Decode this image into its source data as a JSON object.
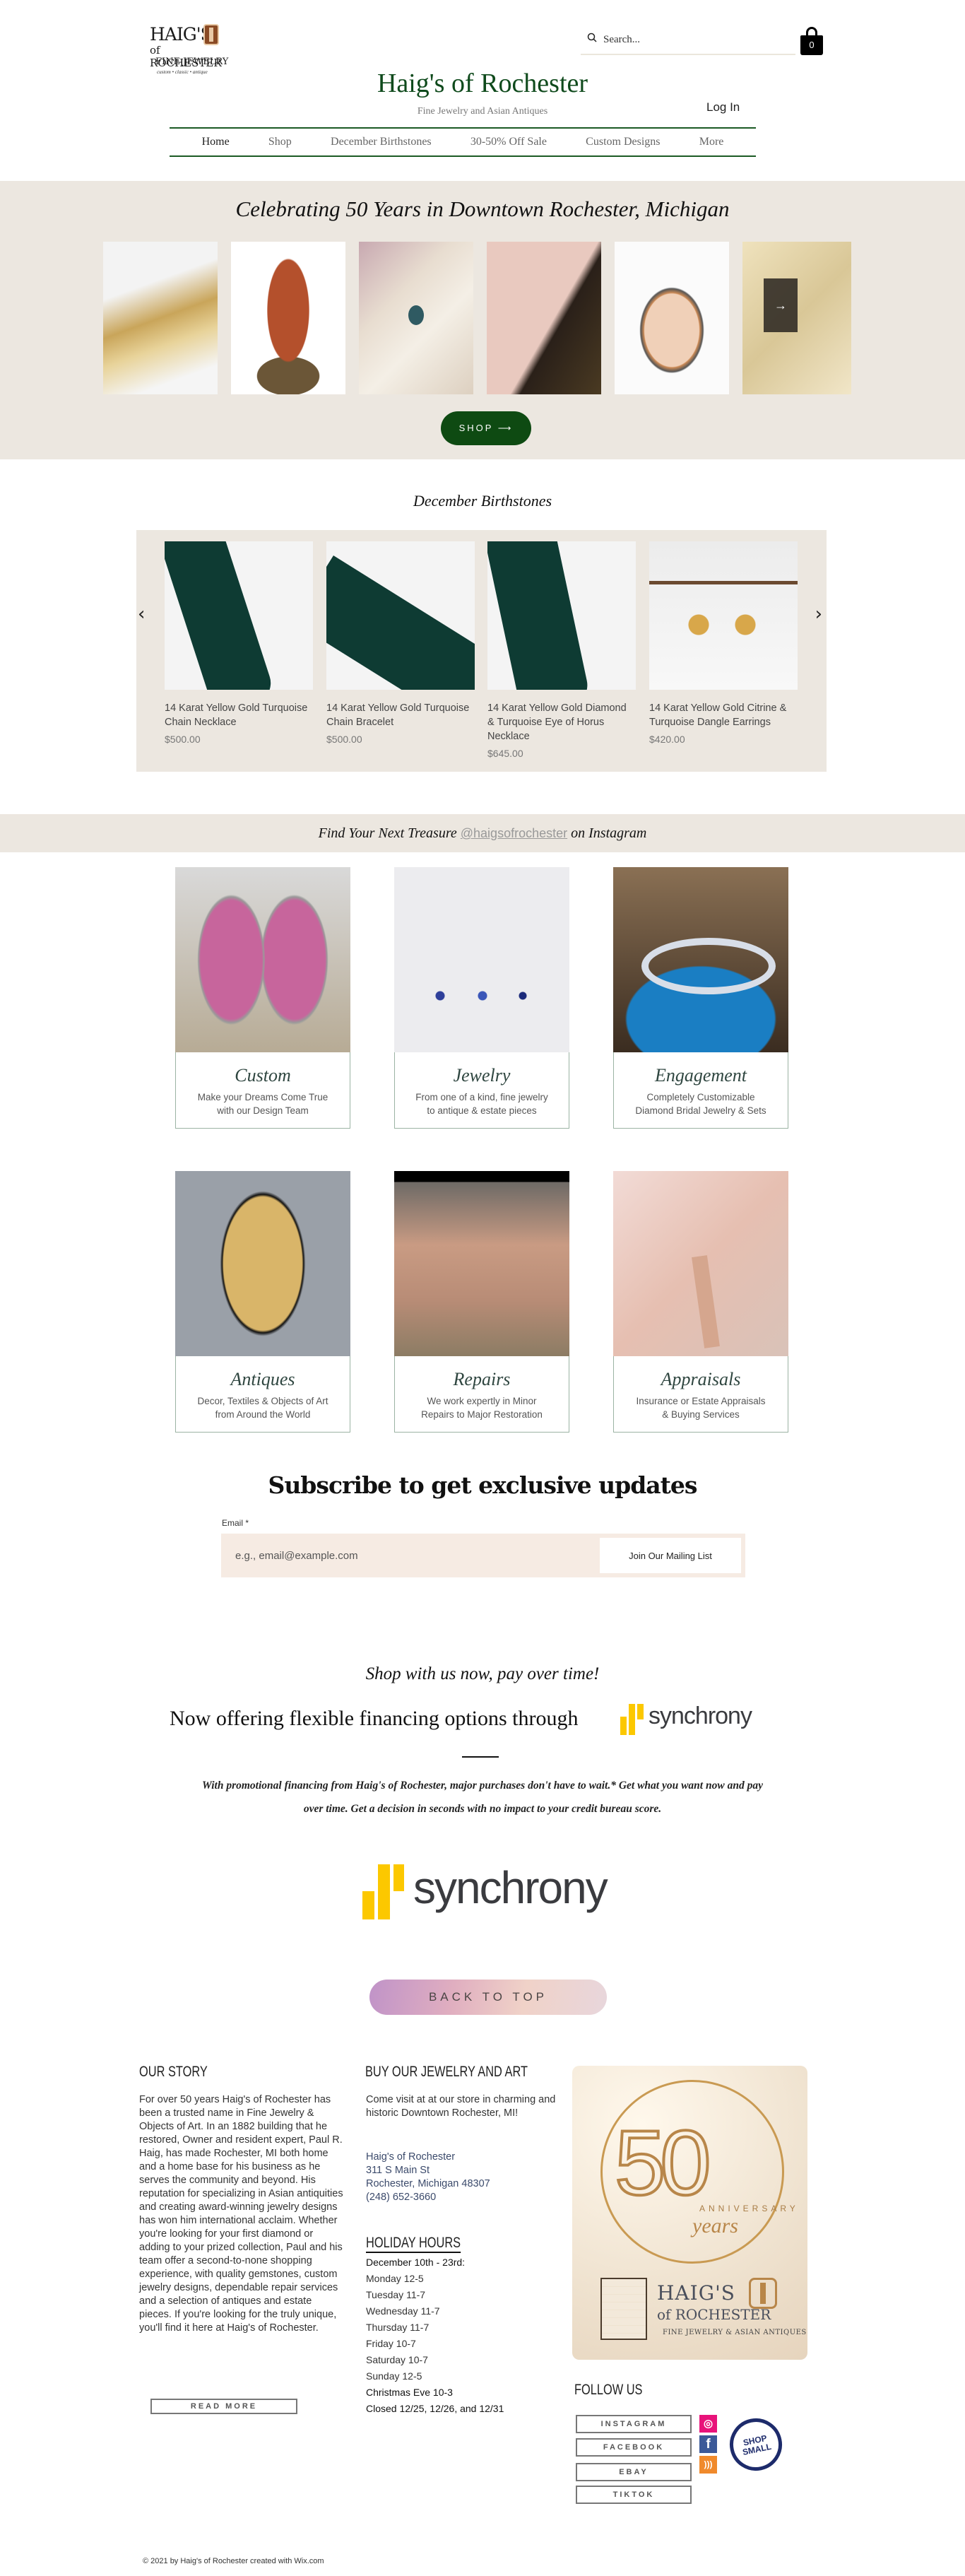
{
  "header": {
    "logo": {
      "line1": "HAIG'S",
      "line2": "of ROCHESTER",
      "line3": "FINE JEWELRY",
      "line4": "custom • classic • antique"
    },
    "search": {
      "placeholder": "Search..."
    },
    "cart": {
      "count": "0"
    },
    "site_title": "Haig's of Rochester",
    "site_subtitle": "Fine Jewelry and Asian Antiques",
    "login_label": "Log In",
    "nav": [
      {
        "label": "Home",
        "active": true
      },
      {
        "label": "Shop"
      },
      {
        "label": "December Birthstones"
      },
      {
        "label": "30-50% Off Sale"
      },
      {
        "label": "Custom Designs"
      },
      {
        "label": "More"
      }
    ]
  },
  "hero": {
    "title": "Celebrating 50 Years in Downtown Rochester, Michigan",
    "gallery_next_icon": "→",
    "shop_label": "SHOP ⟶"
  },
  "birthstones": {
    "title": "December Birthstones",
    "prev_icon": "‹",
    "next_icon": "›",
    "products": [
      {
        "name": "14 Karat Yellow Gold Turquoise Chain Necklace",
        "price": "$500.00"
      },
      {
        "name": "14 Karat Yellow Gold Turquoise Chain Bracelet",
        "price": "$500.00"
      },
      {
        "name": "14 Karat Yellow Gold Diamond & Turquoise Eye of Horus Necklace",
        "price": "$645.00"
      },
      {
        "name": "14 Karat Yellow Gold Citrine & Turquoise Dangle Earrings",
        "price": "$420.00"
      }
    ]
  },
  "instagram": {
    "prefix": "Find Your Next Treasure ",
    "handle": "@haigsofrochester",
    "suffix": " on Instagram"
  },
  "categories": [
    {
      "title": "Custom",
      "line1": "Make your Dreams Come True",
      "line2": "with our Design Team"
    },
    {
      "title": "Jewelry",
      "line1": "From one of a kind, fine jewelry",
      "line2": "to antique & estate pieces"
    },
    {
      "title": "Engagement",
      "line1": "Completely Customizable",
      "line2": "Diamond Bridal Jewelry & Sets"
    },
    {
      "title": "Antiques",
      "line1": "Decor, Textiles & Objects of Art",
      "line2": "from Around the World"
    },
    {
      "title": "Repairs",
      "line1": "We work expertly in Minor",
      "line2": "Repairs to Major Restoration"
    },
    {
      "title": "Appraisals",
      "line1": "Insurance or Estate Appraisals",
      "line2": "& Buying Services"
    }
  ],
  "subscribe": {
    "title": "Subscribe to get exclusive updates",
    "email_label": "Email *",
    "email_placeholder": "e.g., email@example.com",
    "button_label": "Join Our Mailing List"
  },
  "financing": {
    "tagline": "Shop with us now, pay over time!",
    "headline": "Now offering flexible financing options through",
    "brand": "synchrony",
    "body": "With promotional financing from Haig's of Rochester, major purchases don't have to wait.* Get what you want now and pay over time. Get a decision in seconds with no impact to your credit bureau score.",
    "brand_color": "#fcc800"
  },
  "back_to_top_label": "BACK TO TOP",
  "footer": {
    "story": {
      "heading": "OUR STORY",
      "text": "For over 50 years Haig's of Rochester has been a trusted name in Fine Jewelry & Objects of Art. In an 1882 building that he restored, Owner and resident expert, Paul R. Haig, has made Rochester, MI both home and a home base for his business as he serves the community and beyond. His reputation for specializing in Asian antiquities and creating award-winning jewelry designs has won him international acclaim. Whether you're looking for your first diamond or adding to your prized collection, Paul and his team offer a second-to-none shopping experience, with quality gemstones, custom jewelry designs, dependable repair services and a selection of antiques and estate pieces. If you're looking for the truly unique, you'll find it here at Haig's of Rochester.",
      "read_more": "READ MORE"
    },
    "buy": {
      "heading": "BUY OUR JEWELRY AND ART",
      "text": "Come visit at at our store in charming and historic Downtown Rochester, MI!",
      "address_name": "Haig's of Rochester",
      "address_street": "311 S Main St",
      "address_city": "Rochester, Michigan 48307",
      "phone": "(248) 652-3660"
    },
    "hours": {
      "heading": "HOLIDAY HOURS",
      "range": "December 10th - 23rd:",
      "days": [
        "Monday 12-5",
        "Tuesday 11-7",
        "Wednesday 11-7",
        "Thursday 11-7",
        "Friday 10-7",
        "Saturday 10-7",
        "Sunday 12-5"
      ],
      "christmas_eve": "Christmas Eve 10-3",
      "closed": "Closed 12/25, 12/26, and 12/31"
    },
    "anniversary": {
      "number": "50",
      "anniversary_word": "ANNIVERSARY",
      "years_word": "years",
      "brand_name": "HAIG'S",
      "brand_sub": "of ROCHESTER",
      "brand_tag": "FINE JEWELRY & ASIAN ANTIQUES"
    },
    "follow": {
      "heading": "FOLLOW US",
      "buttons": [
        "INSTAGRAM",
        "FACEBOOK",
        "EBAY",
        "TIKTOK"
      ],
      "shop_small": "SHOP SMALL"
    },
    "copyright": "© 2021 by Haig's of Rochester created with Wix.com"
  }
}
